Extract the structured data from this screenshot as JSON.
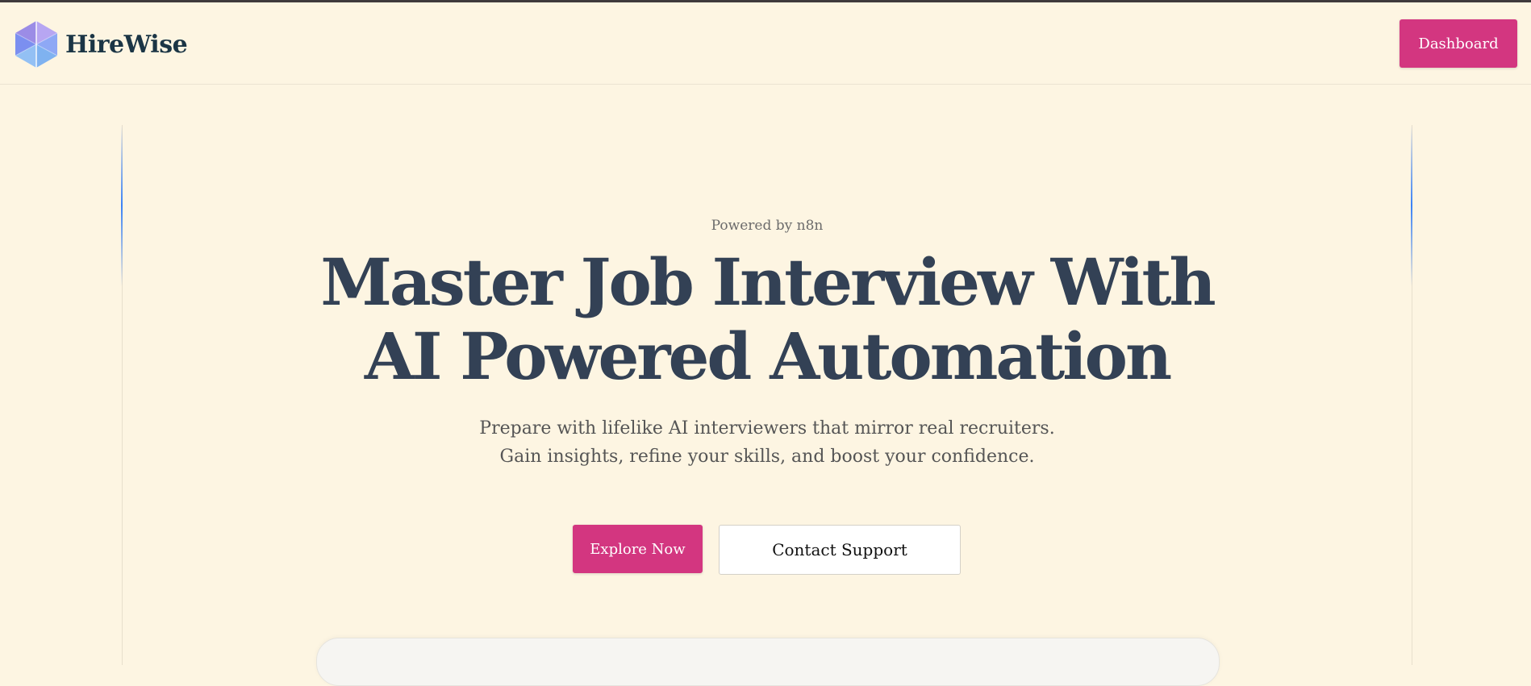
{
  "brand": {
    "name": "HireWise",
    "logo_icon": "hexagon-logo-icon"
  },
  "nav": {
    "dashboard_label": "Dashboard"
  },
  "hero": {
    "eyebrow": "Powered by n8n",
    "headline_line1": "Master Job Interview With",
    "headline_line2": "AI Powered Automation",
    "subtitle": "Prepare with lifelike AI interviewers that mirror real recruiters. Gain insights, refine your skills, and boost your confidence."
  },
  "cta": {
    "explore_label": "Explore Now",
    "contact_label": "Contact Support"
  },
  "colors": {
    "background": "#fdf5e2",
    "accent": "#d33680",
    "heading": "#334155",
    "beam": "#3b82f6"
  }
}
